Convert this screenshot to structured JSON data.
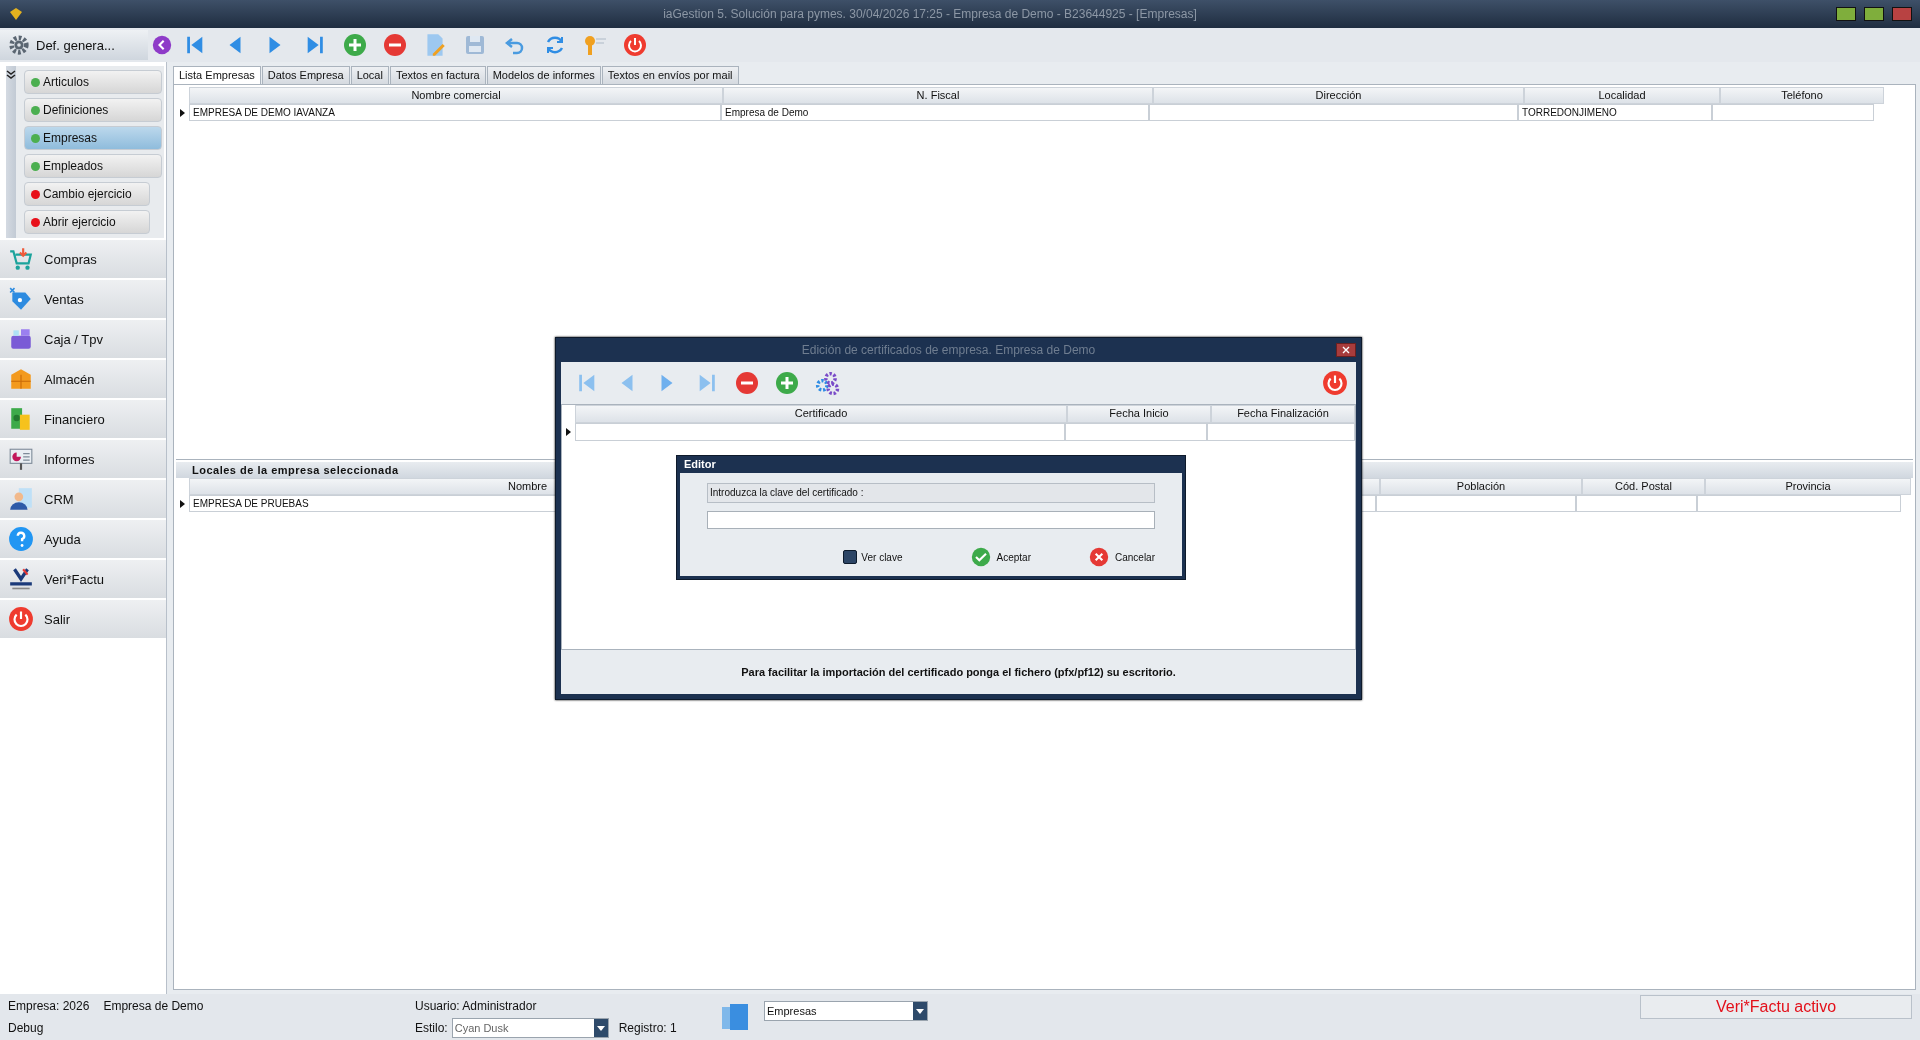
{
  "window": {
    "title": "iaGestion 5. Solución para pymes.  30/04/2026 17:25  -  Empresa de Demo - B23644925 - [Empresas]"
  },
  "module_button": {
    "label": "Def. genera..."
  },
  "submenu": [
    {
      "label": "Articulos",
      "color": "#4caf50",
      "selected": false
    },
    {
      "label": "Definiciones",
      "color": "#4caf50",
      "selected": false
    },
    {
      "label": "Empresas",
      "color": "#4caf50",
      "selected": true
    },
    {
      "label": "Empleados",
      "color": "#4caf50",
      "selected": false
    },
    {
      "label": "Cambio ejercicio",
      "color": "#e8101a",
      "selected": false
    },
    {
      "label": "Abrir ejercicio",
      "color": "#e8101a",
      "selected": false
    }
  ],
  "modules": [
    {
      "label": "Compras"
    },
    {
      "label": "Ventas"
    },
    {
      "label": "Caja / Tpv"
    },
    {
      "label": "Almacén"
    },
    {
      "label": "Financiero"
    },
    {
      "label": "Informes"
    },
    {
      "label": "CRM"
    },
    {
      "label": "Ayuda"
    },
    {
      "label": "Veri*Factu"
    },
    {
      "label": "Salir"
    }
  ],
  "tabs": [
    {
      "label": "Lista Empresas",
      "selected": true
    },
    {
      "label": "Datos Empresa",
      "selected": false
    },
    {
      "label": "Local",
      "selected": false
    },
    {
      "label": "Textos en factura",
      "selected": false
    },
    {
      "label": "Modelos de informes",
      "selected": false
    },
    {
      "label": "Textos en envíos por mail",
      "selected": false
    }
  ],
  "companies_table": {
    "columns": [
      "Nombre comercial",
      "N. Fiscal",
      "Dirección",
      "Localidad",
      "Teléfono"
    ],
    "rows": [
      [
        "EMPRESA DE DEMO IAVANZA",
        "Empresa de Demo",
        "",
        "TORREDONJIMENO",
        ""
      ]
    ]
  },
  "section_title": "Locales de la empresa seleccionada",
  "locales_table": {
    "columns": [
      "Nombre",
      "Población",
      "Cód. Postal",
      "Provincia"
    ],
    "rows": [
      [
        "EMPRESA DE PRUEBAS"
      ]
    ]
  },
  "dialog": {
    "title": "Edición de certificados de empresa. Empresa de Demo",
    "columns": [
      "Certificado",
      "Fecha Inicio",
      "Fecha Finalización"
    ],
    "note": "Para facilitar la importación del certificado ponga el fichero (pfx/pf12) su escritorio."
  },
  "editor": {
    "title": "Editor",
    "prompt": "Introduzca la clave del certificado :",
    "show_password": {
      "label": "Ver clave",
      "checked": false
    },
    "buttons": [
      {
        "label": "Aceptar",
        "kind": "ok"
      },
      {
        "label": "Cancelar",
        "kind": "cancel"
      }
    ]
  },
  "status": {
    "company_label": "Empresa:  2026",
    "company_name": "Empresa de Demo",
    "mode": "Debug",
    "user": "Usuario: Administrador",
    "style_label": "Estilo:",
    "style_value": "Cyan Dusk",
    "record": "Registro:  1",
    "form_value": "Empresas",
    "verifactu": "Veri*Factu activo"
  }
}
